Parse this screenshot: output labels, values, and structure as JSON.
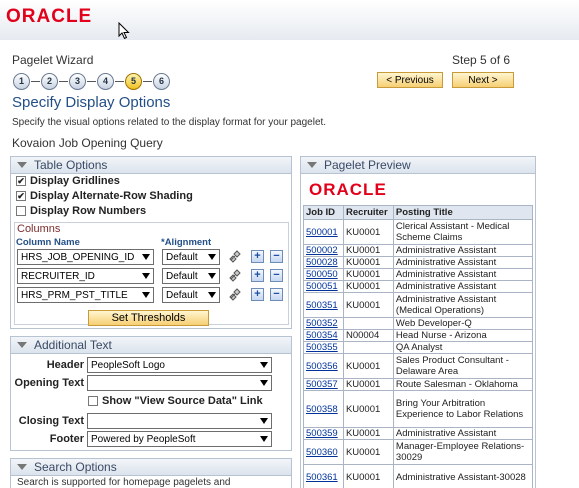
{
  "app": {
    "logo": "ORACLE"
  },
  "wizard": {
    "title": "Pagelet Wizard",
    "step_text": "Step 5 of 6",
    "steps": [
      "1",
      "2",
      "3",
      "4",
      "5",
      "6"
    ],
    "current_step": 5
  },
  "nav": {
    "previous_label": "< Previous",
    "next_label": "Next >"
  },
  "page": {
    "heading": "Specify Display Options",
    "description": "Specify the visual options related to the display format for your pagelet.",
    "query_name": "Kovaion Job Opening Query"
  },
  "table_options": {
    "title": "Table Options",
    "display_gridlines": {
      "label": "Display Gridlines",
      "checked": true
    },
    "display_alt_shading": {
      "label": "Display Alternate-Row Shading",
      "checked": true
    },
    "display_row_numbers": {
      "label": "Display Row Numbers",
      "checked": false
    },
    "columns_title": "Columns",
    "col_header_name": "Column Name",
    "col_header_alignment": "*Alignment",
    "rows": [
      {
        "name": "HRS_JOB_OPENING_ID",
        "alignment": "Default"
      },
      {
        "name": "RECRUITER_ID",
        "alignment": "Default"
      },
      {
        "name": "HRS_PRM_PST_TITLE",
        "alignment": "Default"
      }
    ],
    "set_thresholds_label": "Set Thresholds"
  },
  "additional_text": {
    "title": "Additional Text",
    "header_label": "Header",
    "header_value": "PeopleSoft Logo",
    "opening_label": "Opening Text",
    "opening_value": "",
    "view_source_label": "Show \"View Source Data\" Link",
    "closing_label": "Closing Text",
    "closing_value": "",
    "footer_label": "Footer",
    "footer_value": "Powered by PeopleSoft"
  },
  "search_options": {
    "title": "Search Options",
    "desc": "Search is supported for homepage pagelets and"
  },
  "preview": {
    "title": "Pagelet Preview",
    "logo": "ORACLE",
    "headers": [
      "Job ID",
      "Recruiter",
      "Posting Title"
    ],
    "rows": [
      {
        "id": "500001",
        "recruiter": "KU0001",
        "title": "Clerical Assistant - Medical Scheme Claims"
      },
      {
        "id": "500002",
        "recruiter": "KU0001",
        "title": "Administrative Assistant"
      },
      {
        "id": "500028",
        "recruiter": "KU0001",
        "title": "Administrative Assistant"
      },
      {
        "id": "500050",
        "recruiter": "KU0001",
        "title": "Administrative Assistant"
      },
      {
        "id": "500051",
        "recruiter": "KU0001",
        "title": "Administrative Assistant"
      },
      {
        "id": "500351",
        "recruiter": "KU0001",
        "title": "Administrative Assistant (Medical Operations)"
      },
      {
        "id": "500352",
        "recruiter": "",
        "title": "Web Developer-Q"
      },
      {
        "id": "500354",
        "recruiter": "N00004",
        "title": "Head Nurse - Arizona"
      },
      {
        "id": "500355",
        "recruiter": "",
        "title": "QA Analyst"
      },
      {
        "id": "500356",
        "recruiter": "KU0001",
        "title": "Sales Product Consultant - Delaware Area"
      },
      {
        "id": "500357",
        "recruiter": "KU0001",
        "title": "Route Salesman - Oklahoma"
      },
      {
        "id": "500358",
        "recruiter": "KU0001",
        "title": "Bring Your Arbitration Experience to Labor Relations"
      },
      {
        "id": "500359",
        "recruiter": "KU0001",
        "title": "Administrative Assistant"
      },
      {
        "id": "500360",
        "recruiter": "KU0001",
        "title": "Manager-Employee Relations-30029"
      },
      {
        "id": "500361",
        "recruiter": "KU0001",
        "title": "Administrative Assistant-30028"
      }
    ]
  }
}
